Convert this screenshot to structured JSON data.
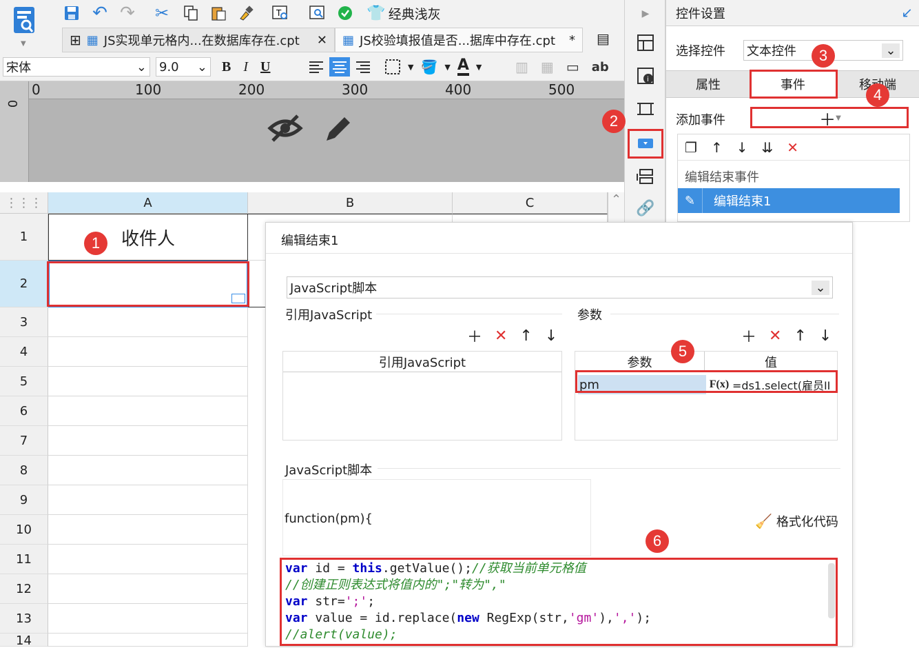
{
  "toolbar": {
    "theme_label": "经典浅灰",
    "tabs": [
      {
        "label": "JS实现单元格内...在数据库存在.cpt",
        "close": "✕"
      },
      {
        "label": "JS校验填报值是否...据库中存在.cpt",
        "close": "*"
      }
    ],
    "font_name": "宋体",
    "font_size": "9.0",
    "bold": "B",
    "italic": "I",
    "underline": "U",
    "text_a": "A",
    "ab": "ab"
  },
  "ruler": {
    "marks": [
      "0",
      "100",
      "200",
      "300",
      "400",
      "500"
    ],
    "v0": "0"
  },
  "sheet": {
    "columns": [
      "A",
      "B",
      "C"
    ],
    "rows": [
      "1",
      "2",
      "3",
      "4",
      "5",
      "6",
      "7",
      "8",
      "9",
      "10",
      "11",
      "12",
      "13",
      "14"
    ],
    "a1_value": "收件人"
  },
  "right_panel": {
    "title": "控件设置",
    "select_label": "选择控件",
    "select_value": "文本控件",
    "tabs": [
      "属性",
      "事件",
      "移动端"
    ],
    "add_event_label": "添加事件",
    "event_group": "编辑结束事件",
    "event_item": "编辑结束1"
  },
  "dialog": {
    "title": "编辑结束1",
    "script_type": "JavaScript脚本",
    "ref_js_label": "引用JavaScript",
    "ref_js_col": "引用JavaScript",
    "params_label": "参数",
    "param_col": "参数",
    "value_col": "值",
    "param_name": "pm",
    "param_value": "=ds1.select(雇员II",
    "script_label": "JavaScript脚本",
    "function_sig": "function(pm){",
    "format_code": "格式化代码"
  },
  "markers": [
    "1",
    "2",
    "3",
    "4",
    "5",
    "6"
  ],
  "colors": {
    "accent": "#3a8ee6",
    "marker": "#e53935",
    "selected_row": "#3d8fe0"
  }
}
